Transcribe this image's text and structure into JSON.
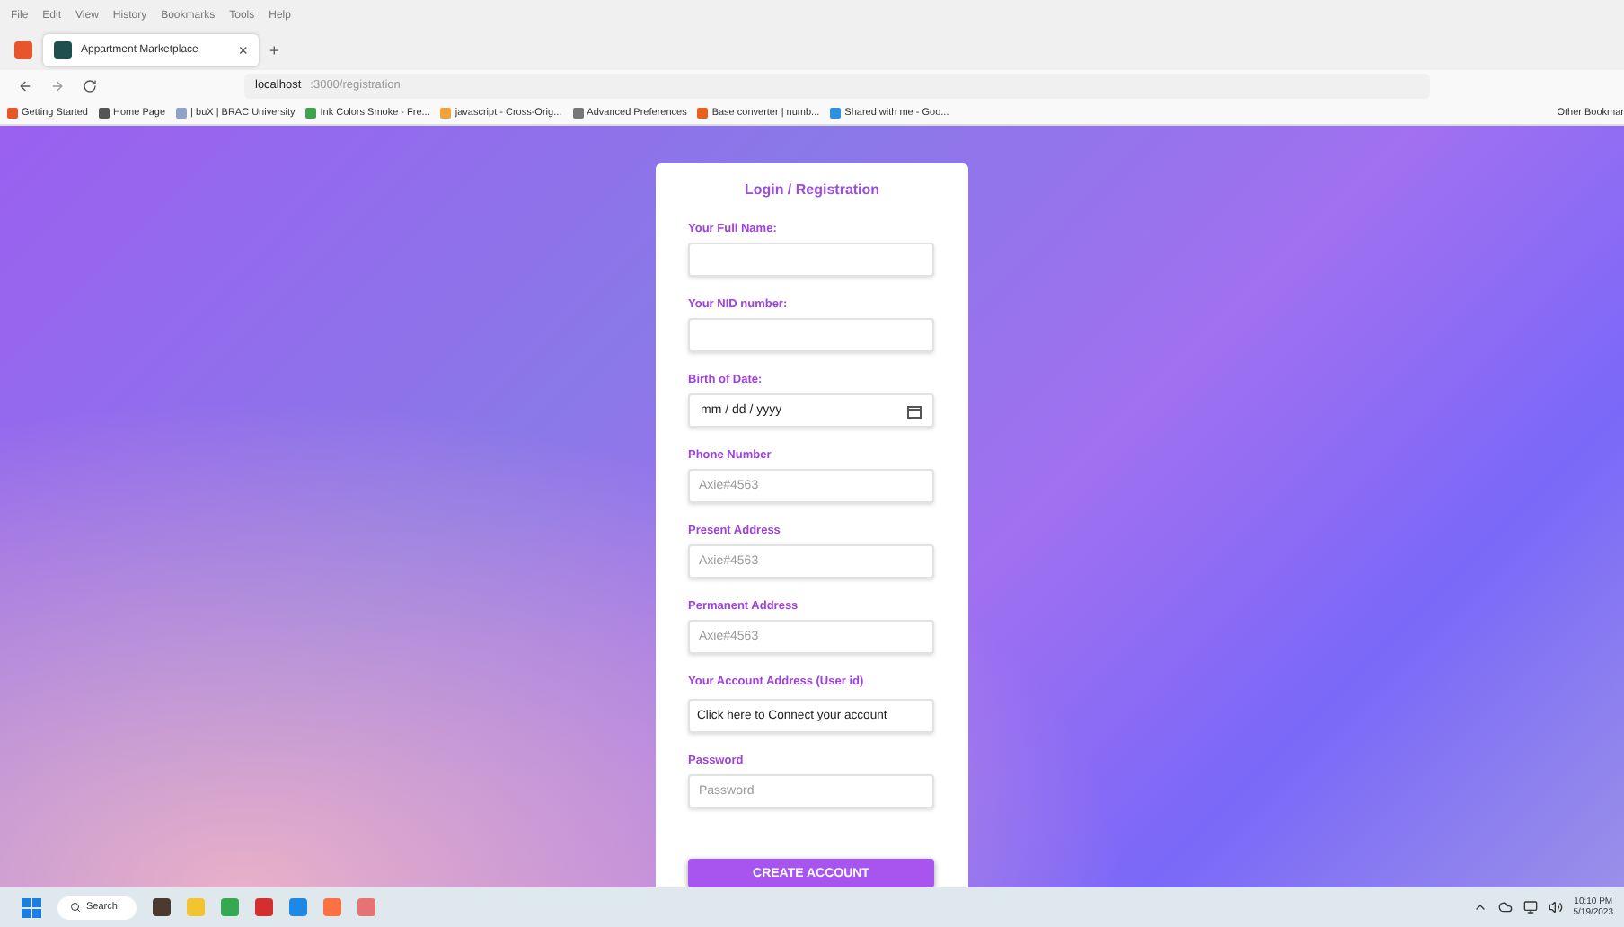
{
  "menu": [
    "File",
    "Edit",
    "View",
    "History",
    "Bookmarks",
    "Tools",
    "Help"
  ],
  "tab": {
    "title": "Appartment Marketplace",
    "close": "×",
    "new_tab": "+"
  },
  "address": {
    "host": "localhost",
    "path": ":3000/registration"
  },
  "bookmarks": [
    {
      "label": "Getting Started",
      "color": "#e8552a"
    },
    {
      "label": "Home Page",
      "color": "#555555"
    },
    {
      "label": "| buX | BRAC University",
      "color": "#8fa3c8"
    },
    {
      "label": "Ink Colors Smoke - Fre...",
      "color": "#3fa34d"
    },
    {
      "label": "javascript - Cross-Orig...",
      "color": "#f2a23a"
    },
    {
      "label": "Advanced Preferences",
      "color": "#777777"
    },
    {
      "label": "Base converter | numb...",
      "color": "#e8601c"
    },
    {
      "label": "Shared with me - Goo...",
      "color": "#2f8fe0"
    }
  ],
  "other_bookmarks": "Other Bookmar",
  "form": {
    "title": "Login / Registration",
    "fields": [
      {
        "kind": "text",
        "label": "Your Full Name:"
      },
      {
        "kind": "text",
        "label": "Your NID number:"
      },
      {
        "kind": "date",
        "label": "Birth of Date:",
        "value": "mm / dd / yyyy"
      },
      {
        "kind": "text",
        "label": "Phone Number",
        "placeholder": "Axie#4563"
      },
      {
        "kind": "text",
        "label": "Present Address",
        "placeholder": "Axie#4563"
      },
      {
        "kind": "text",
        "label": "Permanent Address",
        "placeholder": "Axie#4563"
      },
      {
        "kind": "button",
        "label": "Your Account Address (User id)",
        "value": "Click here to Connect your account"
      },
      {
        "kind": "text",
        "label": "Password",
        "placeholder": "Password"
      }
    ],
    "submit": "CREATE ACCOUNT"
  },
  "taskbar": {
    "search": "Search",
    "time": "10:10 PM",
    "date": "5/19/2023"
  }
}
